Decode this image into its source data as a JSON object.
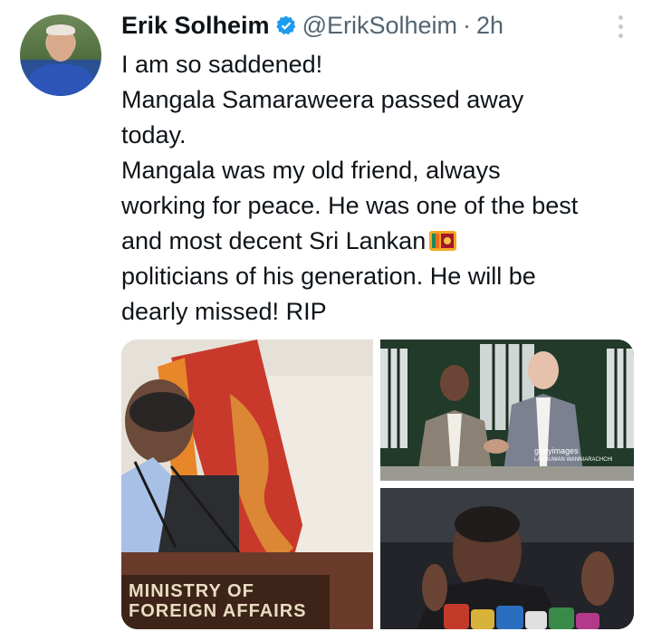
{
  "tweet": {
    "author_name": "Erik Solheim",
    "handle": "@ErikSolheim",
    "separator": "·",
    "time": "2h",
    "lines": [
      "I am so saddened!",
      "Mangala Samaraweera passed away",
      "today.",
      "Mangala was my old friend, always",
      "working for peace. He was one of the best",
      "and most decent Sri Lankan",
      "politicians of his generation. He will be",
      "dearly missed! RIP"
    ],
    "flag_emoji_name": "sri-lanka-flag-icon"
  },
  "media": {
    "podium_line1": "MINISTRY OF",
    "podium_line2": "FOREIGN AFFAIRS",
    "watermark_line1": "gettyimages",
    "watermark_line2": "LAKRUWAN WANNIARACHCHI"
  },
  "colors": {
    "text": "#0f1419",
    "secondary": "#536471",
    "verified": "#1d9bf0"
  }
}
